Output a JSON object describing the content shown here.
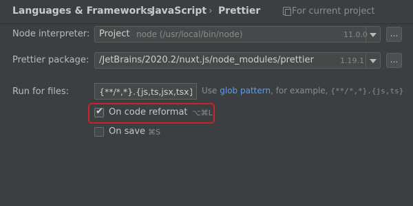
{
  "breadcrumb": {
    "items": [
      "Languages & Frameworks",
      "JavaScript",
      "Prettier"
    ],
    "separator": "›",
    "scope_label": "For current project"
  },
  "node_interpreter": {
    "label": "Node interpreter:",
    "value": "Project",
    "hint": "node (/usr/local/bin/node)",
    "version": "11.0.0",
    "browse_label": "..."
  },
  "prettier_package": {
    "label": "Prettier package:",
    "value": "/JetBrains/2020.2/nuxt.js/node_modules/prettier",
    "version": "1.19.1",
    "browse_label": "..."
  },
  "run_for_files": {
    "label": "Run for files:",
    "value": "{**/*,*}.{js,ts,jsx,tsx}",
    "help_prefix": "Use",
    "help_link": "glob pattern",
    "help_middle": ", for example,",
    "help_example": "{**/*,*}.{js,ts}"
  },
  "on_code_reformat": {
    "label": "On code reformat",
    "shortcut": "⌥⌘L",
    "checked": true
  },
  "on_save": {
    "label": "On save",
    "shortcut": "⌘S",
    "checked": false
  },
  "colors": {
    "background": "#3c3f41",
    "link": "#589df6",
    "highlight_border": "#d0222c"
  }
}
